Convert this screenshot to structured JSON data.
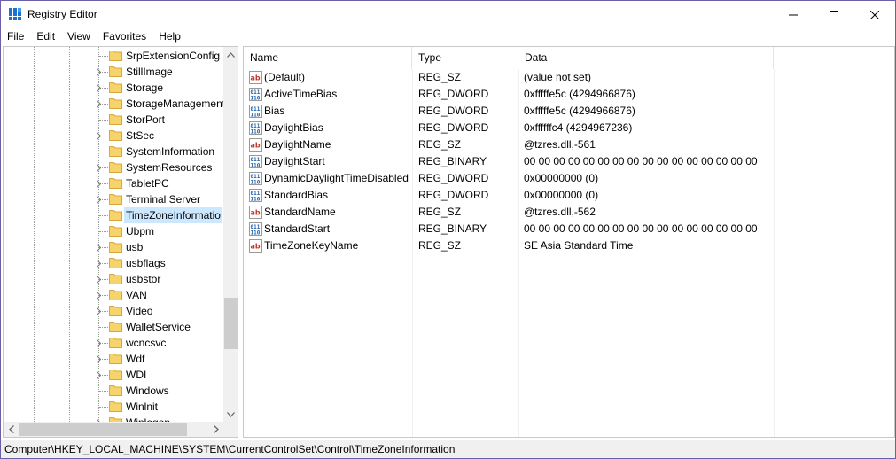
{
  "window": {
    "title": "Registry Editor",
    "minimize_glyph": "—",
    "maximize_glyph": "☐",
    "close_glyph": "✕"
  },
  "menu": [
    "File",
    "Edit",
    "View",
    "Favorites",
    "Help"
  ],
  "tree": {
    "selected": "TimeZoneInformation",
    "items": [
      {
        "label": "SrpExtensionConfig",
        "expandable": false
      },
      {
        "label": "StillImage",
        "expandable": true
      },
      {
        "label": "Storage",
        "expandable": true
      },
      {
        "label": "StorageManagement",
        "expandable": true
      },
      {
        "label": "StorPort",
        "expandable": false
      },
      {
        "label": "StSec",
        "expandable": true
      },
      {
        "label": "SystemInformation",
        "expandable": false
      },
      {
        "label": "SystemResources",
        "expandable": true
      },
      {
        "label": "TabletPC",
        "expandable": true
      },
      {
        "label": "Terminal Server",
        "expandable": true
      },
      {
        "label": "TimeZoneInformatio",
        "expandable": false
      },
      {
        "label": "Ubpm",
        "expandable": false
      },
      {
        "label": "usb",
        "expandable": true
      },
      {
        "label": "usbflags",
        "expandable": true
      },
      {
        "label": "usbstor",
        "expandable": true
      },
      {
        "label": "VAN",
        "expandable": true
      },
      {
        "label": "Video",
        "expandable": true
      },
      {
        "label": "WalletService",
        "expandable": false
      },
      {
        "label": "wcncsvc",
        "expandable": true
      },
      {
        "label": "Wdf",
        "expandable": true
      },
      {
        "label": "WDI",
        "expandable": true
      },
      {
        "label": "Windows",
        "expandable": false
      },
      {
        "label": "Winlnit",
        "expandable": false
      },
      {
        "label": "Winlogon",
        "expandable": true
      }
    ]
  },
  "values": {
    "columns": {
      "name": "Name",
      "type": "Type",
      "data": "Data"
    },
    "rows": [
      {
        "icon": "string-value-icon",
        "name": "(Default)",
        "type": "REG_SZ",
        "data": "(value not set)"
      },
      {
        "icon": "binary-value-icon",
        "name": "ActiveTimeBias",
        "type": "REG_DWORD",
        "data": "0xfffffe5c (4294966876)"
      },
      {
        "icon": "binary-value-icon",
        "name": "Bias",
        "type": "REG_DWORD",
        "data": "0xfffffe5c (4294966876)"
      },
      {
        "icon": "binary-value-icon",
        "name": "DaylightBias",
        "type": "REG_DWORD",
        "data": "0xffffffc4 (4294967236)"
      },
      {
        "icon": "string-value-icon",
        "name": "DaylightName",
        "type": "REG_SZ",
        "data": "@tzres.dll,-561"
      },
      {
        "icon": "binary-value-icon",
        "name": "DaylightStart",
        "type": "REG_BINARY",
        "data": "00 00 00 00 00 00 00 00 00 00 00 00 00 00 00 00"
      },
      {
        "icon": "binary-value-icon",
        "name": "DynamicDaylightTimeDisabled",
        "type": "REG_DWORD",
        "data": "0x00000000 (0)"
      },
      {
        "icon": "binary-value-icon",
        "name": "StandardBias",
        "type": "REG_DWORD",
        "data": "0x00000000 (0)"
      },
      {
        "icon": "string-value-icon",
        "name": "StandardName",
        "type": "REG_SZ",
        "data": "@tzres.dll,-562"
      },
      {
        "icon": "binary-value-icon",
        "name": "StandardStart",
        "type": "REG_BINARY",
        "data": "00 00 00 00 00 00 00 00 00 00 00 00 00 00 00 00"
      },
      {
        "icon": "string-value-icon",
        "name": "TimeZoneKeyName",
        "type": "REG_SZ",
        "data": "SE Asia Standard Time"
      }
    ]
  },
  "status": {
    "path": "Computer\\HKEY_LOCAL_MACHINE\\SYSTEM\\CurrentControlSet\\Control\\TimeZoneInformation"
  },
  "colors": {
    "selection": "#cce8ff",
    "folder": "#f6d36b",
    "window_border": "#6b5fa8",
    "string_icon": "#c0392b",
    "binary_icon": "#1f5fa8"
  }
}
